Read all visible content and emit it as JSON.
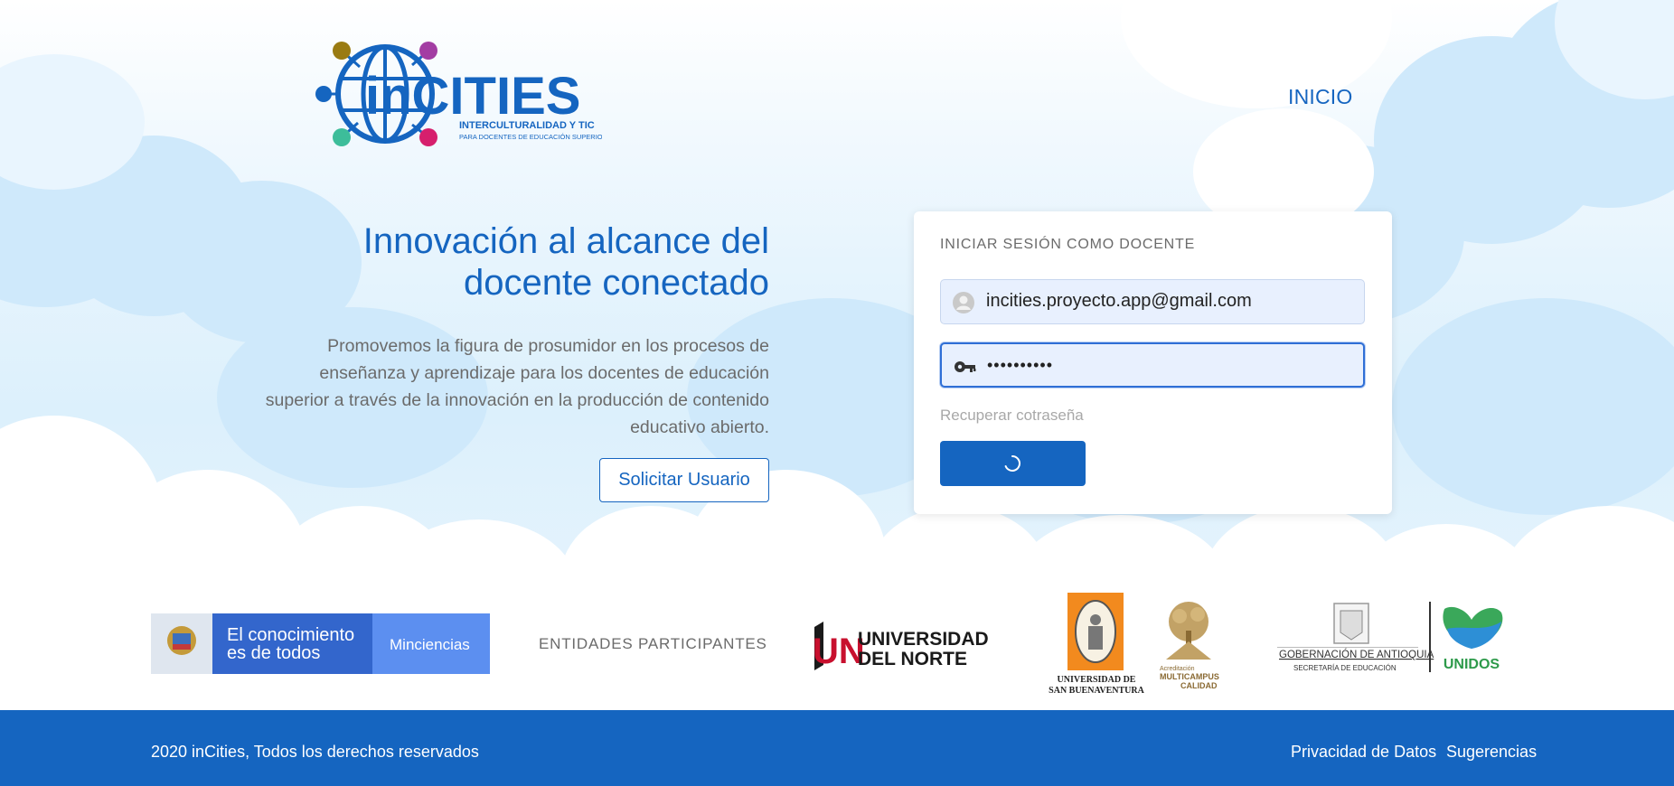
{
  "header": {
    "logo": {
      "brand": "inCITIES",
      "tagline": "INTERCULTURALIDAD Y TIC",
      "subtagline": "PARA DOCENTES DE EDUCACIÓN SUPERIOR"
    },
    "nav_home": "INICIO"
  },
  "hero": {
    "title_line1": "Innovación al alcance del",
    "title_line2": "docente conectado",
    "description": "Promovemos la figura de prosumidor en los procesos de enseñanza y aprendizaje para los docentes de educación superior a través de la innovación en la producción de contenido educativo abierto.",
    "request_button": "Solicitar Usuario"
  },
  "login": {
    "title": "INICIAR SESIÓN COMO DOCENTE",
    "email_value": "incities.proyecto.app@gmail.com",
    "password_value": "••••••••••",
    "recover_link": "Recuperar cotraseña",
    "submit_state": "loading"
  },
  "partners": {
    "minciencias_line1": "El conocimiento",
    "minciencias_line2": "es de todos",
    "minciencias_brand": "Minciencias",
    "label": "ENTIDADES PARTICIPANTES",
    "uninorte_line1": "UNIVERSIDAD",
    "uninorte_line2": "DEL NORTE",
    "usb_line1": "UNIVERSIDAD DE",
    "usb_line2": "SAN BUENAVENTURA",
    "multicampus_line1": "Acreditación",
    "multicampus_line2": "MULTICAMPUS",
    "multicampus_line3": "CALIDAD",
    "antioquia_line1": "GOBERNACIÓN DE ANTIOQUIA",
    "antioquia_line2": "SECRETARÍA DE EDUCACIÓN",
    "unidos": "UNIDOS"
  },
  "footer": {
    "copyright": "2020 inCities, Todos los derechos reservados",
    "privacy": "Privacidad de Datos",
    "suggestions": "Sugerencias"
  },
  "colors": {
    "primary": "#1565c0",
    "text_muted": "#6b6b6b",
    "input_bg": "#e8f0fe"
  }
}
